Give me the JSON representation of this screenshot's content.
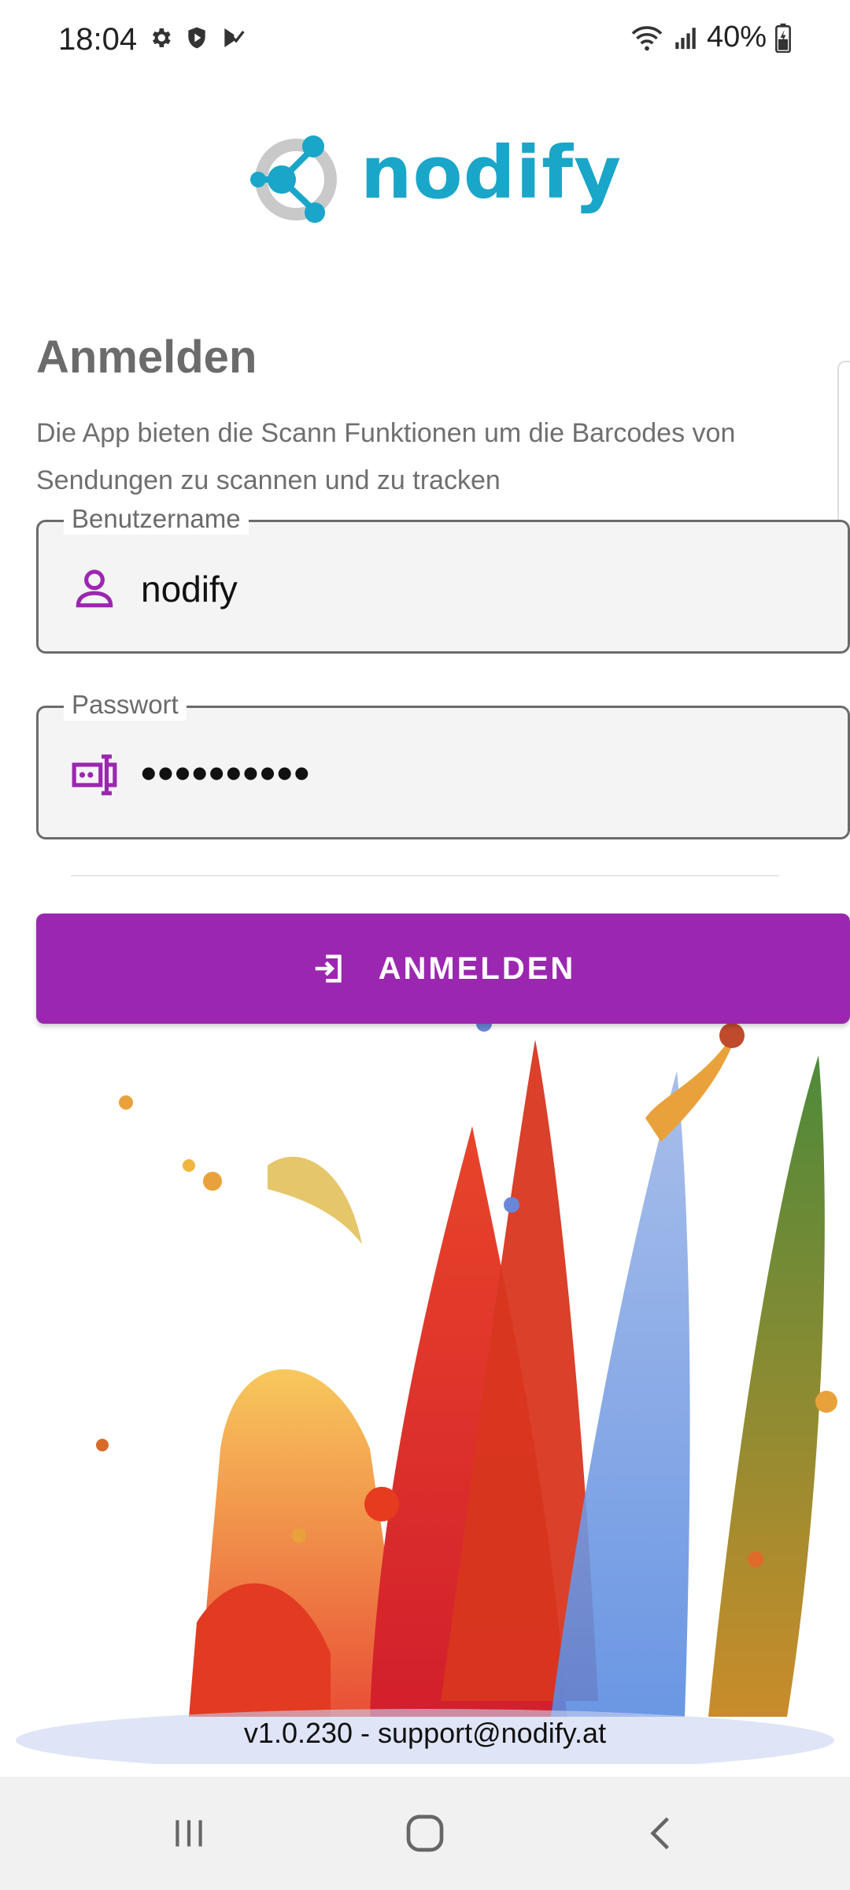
{
  "status_bar": {
    "time": "18:04",
    "battery": "40%"
  },
  "logo": {
    "text": "nodify"
  },
  "login": {
    "title": "Anmelden",
    "description": "Die App bieten die Scann Funktionen um die Barcodes von Sendungen zu scannen und zu tracken",
    "username": {
      "label": "Benutzername",
      "value": "nodify",
      "icon": "person-icon"
    },
    "password": {
      "label": "Passwort",
      "value": "••••••••••",
      "icon": "password-icon"
    },
    "submit_label": "ANMELDEN",
    "submit_icon": "login-icon"
  },
  "footer": {
    "text": "v1.0.230 - support@nodify.at"
  },
  "colors": {
    "accent": "#9b27b0",
    "brand": "#19a6c9",
    "field_bg": "#f4f4f4",
    "navbar_bg": "#f1f1f1"
  }
}
